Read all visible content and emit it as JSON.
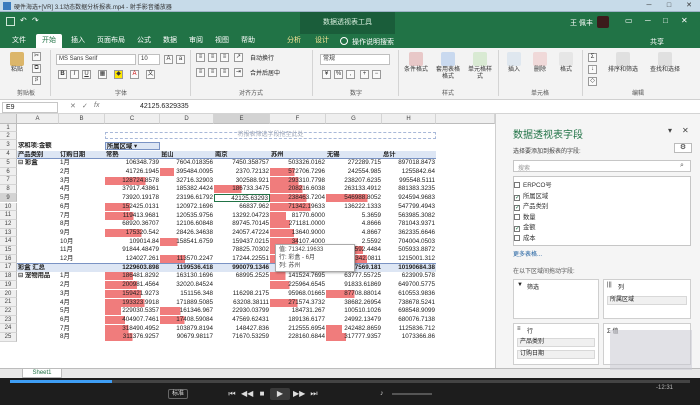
{
  "player": {
    "title": "硬件海选+[VR] 3.1动态数据分析报表.mp4 - 射手影音播放器",
    "time": "-12:31",
    "speed_label": "标准",
    "controls": [
      "⏮",
      "◀◀",
      "■",
      "▶",
      "▶▶",
      "⏭"
    ],
    "win_buttons": [
      "─",
      "□",
      "✕"
    ],
    "progress_percent": 15
  },
  "excel": {
    "title": "演示数据.xlsx - Excel",
    "context_tab": "数据透视表工具",
    "user": "王 佩丰",
    "share": "共享",
    "tell_me": "操作说明搜索",
    "tabs": [
      "文件",
      "开始",
      "插入",
      "页面布局",
      "公式",
      "数据",
      "审阅",
      "视图",
      "帮助",
      "分析",
      "设计"
    ],
    "active_tab": "开始",
    "ribbon": {
      "paste": "粘贴",
      "clipboard": "剪贴板",
      "font_name": "MS Sans Serif",
      "font_size": "10",
      "font_group": "字体",
      "wrap_text": "自动换行",
      "merge_center": "合并后居中",
      "alignment_group": "对齐方式",
      "number_format": "常规",
      "number_group": "数字",
      "conditional_format": "条件格式",
      "format_table": "套用表格格式",
      "cell_styles": "单元格样式",
      "styles_group": "样式",
      "insert": "插入",
      "delete": "删除",
      "format": "格式",
      "cells_group": "单元格",
      "sort_filter": "排序和筛选",
      "find_select": "查找和选择",
      "editing_group": "编辑"
    },
    "name_box": "E9",
    "formula": "42125.6329335"
  },
  "sheet": {
    "columns": [
      "A",
      "B",
      "C",
      "D",
      "E",
      "F",
      "G",
      "H"
    ],
    "drop_page_fields": "将报表筛选字段拖至此处",
    "sum_label": "求和项:金额",
    "region_label": "所属区域",
    "header_row": [
      "产品类别",
      "订购日期",
      "常熟",
      "昆山",
      "南京",
      "苏州",
      "无锡",
      "总计"
    ],
    "rows": [
      {
        "n": "5",
        "a": "彩盒",
        "b": "1月",
        "v": [
          "106348.739",
          "7604.018356",
          "7450.358757",
          "503326.0162",
          "272289.715",
          "897018.8473"
        ]
      },
      {
        "n": "6",
        "a": "",
        "b": "2月",
        "v": [
          "41726.1945",
          "395484.0095",
          "2370.72132",
          "572706.7296",
          "242554.985",
          "1255842.64"
        ]
      },
      {
        "n": "7",
        "a": "",
        "b": "3月",
        "v": [
          "128724.8578",
          "32716.32903",
          "302588.921",
          "293310.7798",
          "238207.6235",
          "995548.5111"
        ]
      },
      {
        "n": "8",
        "a": "",
        "b": "4月",
        "v": [
          "37917.43861",
          "185382.4424",
          "186733.3475",
          "208216.6038",
          "263133.4912",
          "881383.3235"
        ]
      },
      {
        "n": "9",
        "a": "",
        "b": "5月",
        "v": [
          "73920.19178",
          "23196.61792",
          "42125.63293",
          "238463.7204",
          "546988.8052",
          "924594.9683"
        ]
      },
      {
        "n": "10",
        "a": "",
        "b": "6月",
        "v": [
          "152425.0131",
          "120972.1696",
          "66837.962",
          "71342.19633",
          "136222.1333",
          "547799.4943"
        ]
      },
      {
        "n": "11",
        "a": "",
        "b": "7月",
        "v": [
          "119413.9681",
          "120535.9756",
          "13292.04723",
          "81770.6000",
          "5.3659",
          "563985.3082"
        ]
      },
      {
        "n": "12",
        "a": "",
        "b": "8月",
        "v": [
          "68920.36707",
          "12106.60848",
          "89745.70145",
          "271181.0000",
          "4.8666",
          "781043.9371"
        ]
      },
      {
        "n": "13",
        "a": "",
        "b": "9月",
        "v": [
          "175320.542",
          "28426.34638",
          "24057.47224",
          "13640.9000",
          "4.8667",
          "362335.6646"
        ]
      },
      {
        "n": "14",
        "a": "",
        "b": "10月",
        "v": [
          "109014.84",
          "158541.6759",
          "159437.0215",
          "34107.4000",
          "2.5592",
          "704004.0503"
        ]
      },
      {
        "n": "15",
        "a": "",
        "b": "11月",
        "v": [
          "91844.48479",
          "",
          "78825.70302",
          "395771.25099",
          "295592.4484",
          "505933.8872"
        ]
      },
      {
        "n": "16",
        "a": "",
        "b": "12月",
        "v": [
          "124027.261",
          "113570.2247",
          "17244.22551",
          "566771.5191",
          "393342.0811",
          "1215001.312"
        ]
      }
    ],
    "subtotal": {
      "n": "17",
      "a": "彩盒 汇总",
      "v": [
        "1229603.898",
        "1199536.418",
        "990079.1346",
        "3203265.751",
        "3567569.181",
        "10190684.38"
      ]
    },
    "rows2": [
      {
        "n": "18",
        "a": "宠物用品",
        "b": "1月",
        "v": [
          "186481.8292",
          "163130.1696",
          "68995.2525",
          "141524.7695",
          "63777.55725",
          "623909.578"
        ]
      },
      {
        "n": "19",
        "a": "",
        "b": "2月",
        "v": [
          "200981.4564",
          "32020.84524",
          "",
          "225964.6545",
          "91833.61869",
          "649700.5775"
        ]
      },
      {
        "n": "20",
        "a": "",
        "b": "3月",
        "v": [
          "159421.9273",
          "151156.348",
          "116298.2175",
          "95968.01665",
          "87708.88014",
          "610553.9836"
        ]
      },
      {
        "n": "21",
        "a": "",
        "b": "4月",
        "v": [
          "193323.9918",
          "171889.5085",
          "63208.38111",
          "271574.3732",
          "38682.26954",
          "738678.5241"
        ]
      },
      {
        "n": "22",
        "a": "",
        "b": "5月",
        "v": [
          "229030.5357",
          "161346.967",
          "22930.03799",
          "184731.267",
          "100510.1026",
          "698548.9099"
        ]
      },
      {
        "n": "23",
        "a": "",
        "b": "6月",
        "v": [
          "404907.7461",
          "17408.59084",
          "47569.62431",
          "189136.6177",
          "24992.13479",
          "680076.7138"
        ]
      },
      {
        "n": "24",
        "a": "",
        "b": "7月",
        "v": [
          "318490.4952",
          "103879.8194",
          "148427.836",
          "212555.6954",
          "242482.8659",
          "1125836.712"
        ]
      },
      {
        "n": "25",
        "a": "",
        "b": "8月",
        "v": [
          "311376.9257",
          "90679.98117",
          "71670.53259",
          "228160.6844",
          "317777.9357",
          "1073366.86"
        ]
      }
    ],
    "tooltip": [
      "值: 71342.19633",
      "行: 彩盒 - 6月",
      "列: 苏州"
    ],
    "sheet_tab": "Sheet1"
  },
  "pivot_pane": {
    "title": "数据透视表字段",
    "subtitle": "选择要添加到报表的字段:",
    "search_placeholder": "搜索",
    "fields": [
      {
        "label": "ERPCO号",
        "checked": false
      },
      {
        "label": "所属区域",
        "checked": true
      },
      {
        "label": "产品类别",
        "checked": true
      },
      {
        "label": "数量",
        "checked": false
      },
      {
        "label": "金额",
        "checked": true
      },
      {
        "label": "成本",
        "checked": false
      }
    ],
    "more_tables": "更多表格...",
    "drag_hint": "在以下区域间拖动字段:",
    "filter_area": "筛选",
    "columns_area": "列",
    "columns_item": "所属区域",
    "rows_area": "行",
    "rows_items": [
      "产品类别",
      "订购日期"
    ],
    "values_area": "Σ 值"
  },
  "colors": {
    "excel_green": "#217346",
    "highlight_red": "#f07c7c",
    "player_bg": "#1d1d1d",
    "seek_blue": "#3f9ef5"
  }
}
